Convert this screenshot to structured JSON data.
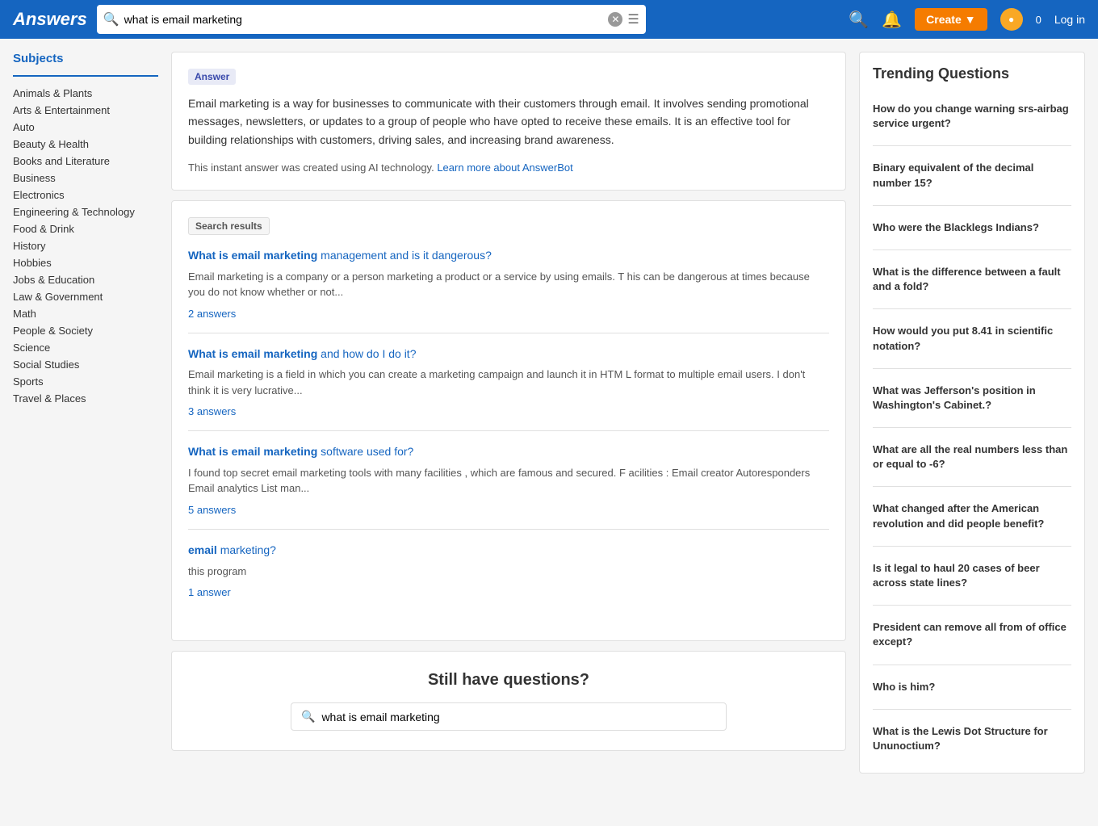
{
  "header": {
    "logo": "Answers",
    "search_value": "what is email marketing",
    "search_placeholder": "what is email marketing",
    "create_label": "Create",
    "login_label": "Log in",
    "points": "0"
  },
  "sidebar": {
    "title": "Subjects",
    "items": [
      "Animals & Plants",
      "Arts & Entertainment",
      "Auto",
      "Beauty & Health",
      "Books and Literature",
      "Business",
      "Electronics",
      "Engineering & Technology",
      "Food & Drink",
      "History",
      "Hobbies",
      "Jobs & Education",
      "Law & Government",
      "Math",
      "People & Society",
      "Science",
      "Social Studies",
      "Sports",
      "Travel & Places"
    ]
  },
  "answer_box": {
    "tag": "Answer",
    "text": "Email marketing is a way for businesses to communicate with their customers through email. It involves sending promotional messages, newsletters, or updates to a group of people who have opted to receive these emails. It is an effective tool for building relationships with customers, driving sales, and increasing brand awareness.",
    "ai_note": "This instant answer was created using AI technology.",
    "ai_link_text": "Learn more about AnswerBot"
  },
  "search_results": {
    "tag": "Search results",
    "items": [
      {
        "title_bold": "What is email marketing",
        "title_rest": " management and is it dangerous?",
        "snippet": "Email marketing is a company or a person marketing a product or a service by using emails. T his can be dangerous at times because you do not know whether or not...",
        "answers_label": "2 answers"
      },
      {
        "title_bold": "What is email marketing",
        "title_rest": " and how do I do it?",
        "snippet": "Email marketing is a field in which you can create a marketing campaign and launch it in HTM L format to multiple email users. I don't think it is very lucrative...",
        "answers_label": "3 answers"
      },
      {
        "title_bold": "What is email marketing",
        "title_rest": " software used for?",
        "snippet": "I found top secret email marketing tools with many facilities , which are famous and secured. F acilities : Email creator Autoresponders Email analytics List man...",
        "answers_label": "5 answers"
      },
      {
        "title_bold": "email",
        "title_rest": " marketing?",
        "snippet": "this program",
        "answers_label": "1 answer"
      }
    ]
  },
  "still_questions": {
    "title": "Still have questions?",
    "search_value": "what is email marketing",
    "search_placeholder": "what is email marketing"
  },
  "trending": {
    "title": "Trending Questions",
    "items": [
      "How do you change warning srs-airbag service urgent?",
      "Binary equivalent of the decimal number 15?",
      "Who were the Blacklegs Indians?",
      "What is the difference between a fault and a fold?",
      "How would you put 8.41 in scientific notation?",
      "What was Jefferson's position in Washington's Cabinet.?",
      "What are all the real numbers less than or equal to -6?",
      "What changed after the American revolution and did people benefit?",
      "Is it legal to haul 20 cases of beer across state lines?",
      "President can remove all from of office except?",
      "Who is him?",
      "What is the Lewis Dot Structure for Ununoctium?"
    ]
  }
}
